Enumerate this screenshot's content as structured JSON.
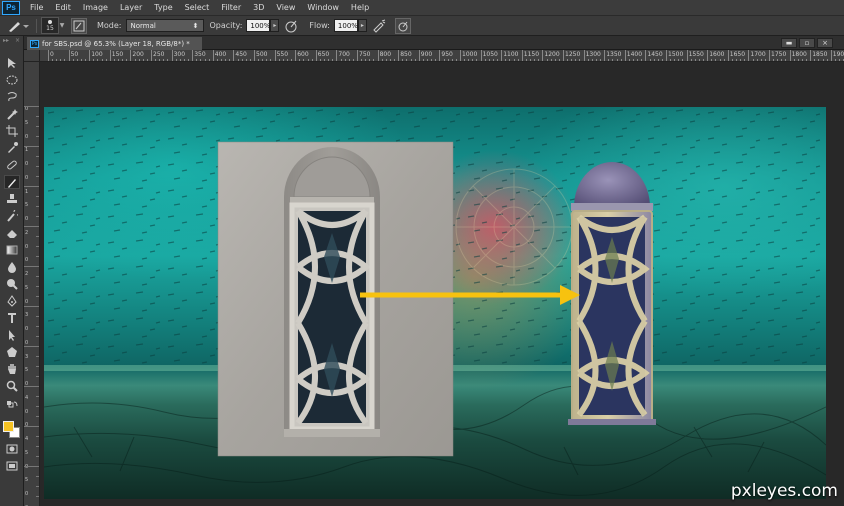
{
  "app": {
    "logo": "Ps"
  },
  "menu": [
    "File",
    "Edit",
    "Image",
    "Layer",
    "Type",
    "Select",
    "Filter",
    "3D",
    "View",
    "Window",
    "Help"
  ],
  "options": {
    "brush_size": "15",
    "mode_label": "Mode:",
    "mode_value": "Normal",
    "opacity_label": "Opacity:",
    "opacity_value": "100%",
    "flow_label": "Flow:",
    "flow_value": "100%"
  },
  "document": {
    "tab_title": "for SBS.psd @ 65.3% (Layer 18, RGB/8*) *",
    "close_label": "×"
  },
  "rulers": {
    "top_labels": [
      "0",
      "50",
      "100",
      "150",
      "200",
      "250",
      "300",
      "350",
      "400",
      "450",
      "500",
      "550",
      "600",
      "650",
      "700",
      "750",
      "800",
      "850",
      "900",
      "950",
      "1000",
      "1050",
      "1100",
      "1150",
      "1200",
      "1250",
      "1300",
      "1350",
      "1400",
      "1450",
      "1500",
      "1550",
      "1600",
      "1650",
      "1700",
      "1750",
      "1800",
      "1850",
      "1900",
      "1950"
    ],
    "left_labels": [
      "0",
      "5",
      "0",
      "1",
      "0",
      "0",
      "1",
      "5",
      "0",
      "2",
      "0",
      "0",
      "2",
      "5",
      "0",
      "3",
      "0",
      "0",
      "3",
      "5",
      "0",
      "4",
      "0",
      "0",
      "4",
      "5",
      "0",
      "5",
      "0",
      "0"
    ]
  },
  "colors": {
    "foreground": "#f6c324",
    "background": "#ffffff",
    "arrow": "#f7c20f"
  },
  "watermark": "pxleyes.com"
}
